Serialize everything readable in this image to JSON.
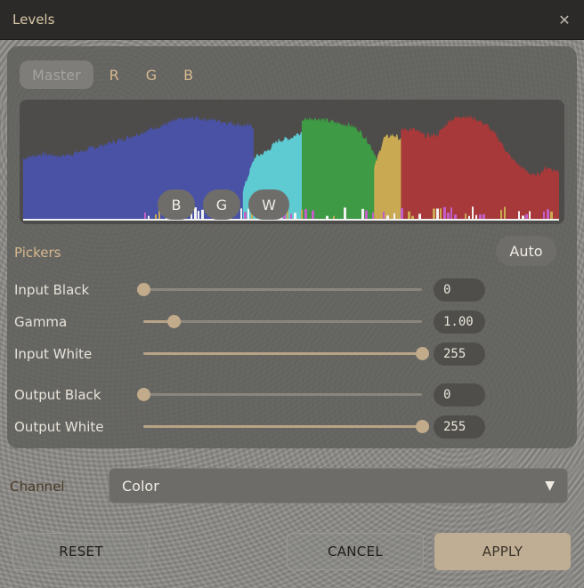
{
  "window": {
    "title": "Levels",
    "close_glyph": "✕"
  },
  "tabs": [
    {
      "label": "Master",
      "active": true
    },
    {
      "label": "R",
      "active": false
    },
    {
      "label": "G",
      "active": false
    },
    {
      "label": "B",
      "active": false
    }
  ],
  "pickers": {
    "label": "Pickers",
    "buttons": [
      "B",
      "G",
      "W"
    ],
    "auto_label": "Auto"
  },
  "sliders": [
    {
      "label": "Input Black",
      "value": "0",
      "fraction": 0.0
    },
    {
      "label": "Gamma",
      "value": "1.00",
      "fraction": 0.11
    },
    {
      "label": "Input White",
      "value": "255",
      "fraction": 1.0
    },
    {
      "label": "Output Black",
      "value": "0",
      "fraction": 0.0
    },
    {
      "label": "Output White",
      "value": "255",
      "fraction": 1.0
    }
  ],
  "channel": {
    "label": "Channel",
    "value": "Color",
    "arrow_glyph": "▼"
  },
  "footer": {
    "reset_label": "RESET",
    "cancel_label": "CANCEL",
    "apply_label": "APPLY"
  },
  "colors": {
    "histogram_blue": "#4a52a6",
    "histogram_cyan": "#5ecad2",
    "histogram_green": "#3e9a44",
    "histogram_yellow": "#c9aa52",
    "histogram_red": "#a8393a",
    "histogram_white": "#f2f2f2",
    "histogram_magenta": "#c25fc7",
    "accent": "#c2ab8a"
  },
  "histogram_bands": [
    {
      "channel": "blue",
      "x0": 0.0,
      "x1": 0.43,
      "profile": [
        0.54,
        0.58,
        0.56,
        0.6,
        0.65,
        0.7,
        0.76,
        0.82,
        0.88,
        0.9,
        0.88,
        0.85,
        0.82
      ]
    },
    {
      "channel": "cyan",
      "x0": 0.41,
      "x1": 0.63,
      "profile": [
        0.25,
        0.55,
        0.6,
        0.7,
        0.72,
        0.78,
        0.8,
        0.8,
        0.78,
        0.75,
        0.72
      ]
    },
    {
      "channel": "green",
      "x0": 0.52,
      "x1": 0.66,
      "profile": [
        0.88,
        0.9,
        0.89,
        0.87,
        0.85,
        0.84,
        0.8,
        0.7,
        0.55
      ]
    },
    {
      "channel": "yellow",
      "x0": 0.655,
      "x1": 0.78,
      "profile": [
        0.45,
        0.72,
        0.75,
        0.7,
        0.55,
        0.44,
        0.42,
        0.4
      ]
    },
    {
      "channel": "red",
      "x0": 0.705,
      "x1": 1.0,
      "profile": [
        0.8,
        0.8,
        0.74,
        0.75,
        0.88,
        0.92,
        0.9,
        0.84,
        0.72,
        0.55,
        0.45,
        0.38,
        0.46,
        0.42
      ]
    }
  ]
}
